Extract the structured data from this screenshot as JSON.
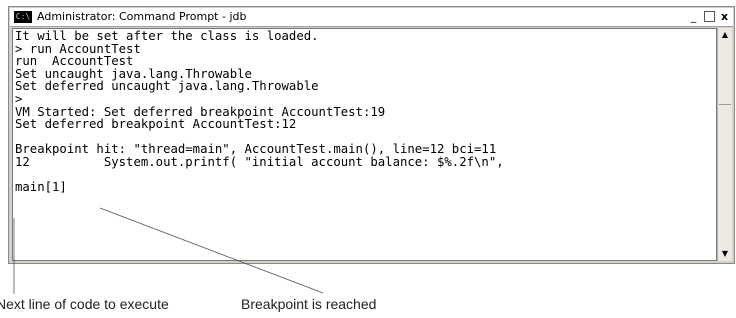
{
  "window": {
    "title": "Administrator: Command Prompt - jdb",
    "app_icon": "C:\\",
    "minimize_label": "_",
    "close_label": "x"
  },
  "console": {
    "lines": [
      "It will be set after the class is loaded.",
      "> run AccountTest",
      "run  AccountTest",
      "Set uncaught java.lang.Throwable",
      "Set deferred uncaught java.lang.Throwable",
      ">",
      "VM Started: Set deferred breakpoint AccountTest:19",
      "Set deferred breakpoint AccountTest:12",
      "",
      "Breakpoint hit: \"thread=main\", AccountTest.main(), line=12 bci=11",
      "12          System.out.printf( \"initial account balance: $%.2f\\n\",",
      "",
      "main[1]"
    ]
  },
  "scrollbar": {
    "up_glyph": "▲",
    "down_glyph": "▼"
  },
  "annotations": {
    "next_line": "Next line of code to execute",
    "breakpoint": "Breakpoint is reached"
  }
}
